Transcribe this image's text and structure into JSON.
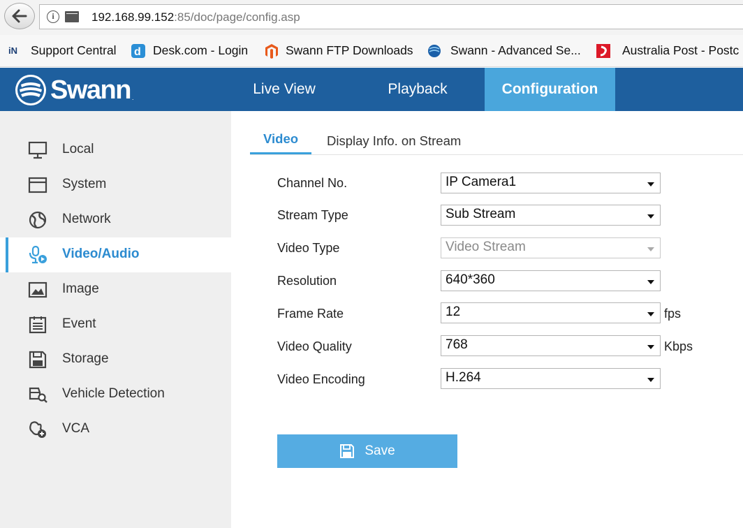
{
  "browser": {
    "url_host": "192.168.99.152",
    "url_rest": ":85/doc/page/config.asp",
    "bookmarks": [
      {
        "label": "Support Central",
        "icon": "in-icon"
      },
      {
        "label": "Desk.com - Login",
        "icon": "desk-icon"
      },
      {
        "label": "Swann FTP Downloads",
        "icon": "magento-icon"
      },
      {
        "label": "Swann - Advanced Se...",
        "icon": "swann-globe-icon"
      },
      {
        "label": "Australia Post - Postc",
        "icon": "auspost-icon"
      }
    ]
  },
  "app": {
    "brand": "Swann",
    "brand_mark": ".",
    "nav": [
      {
        "label": "Live View"
      },
      {
        "label": "Playback"
      },
      {
        "label": "Configuration",
        "active": true
      }
    ],
    "accent_color": "#4aa6dc",
    "header_color": "#1e5f9e"
  },
  "sidebar": {
    "items": [
      {
        "label": "Local",
        "icon": "monitor-icon"
      },
      {
        "label": "System",
        "icon": "window-icon"
      },
      {
        "label": "Network",
        "icon": "globe-icon"
      },
      {
        "label": "Video/Audio",
        "icon": "microphone-icon",
        "active": true
      },
      {
        "label": "Image",
        "icon": "image-icon"
      },
      {
        "label": "Event",
        "icon": "calendar-icon"
      },
      {
        "label": "Storage",
        "icon": "floppy-icon"
      },
      {
        "label": "Vehicle Detection",
        "icon": "vehicle-search-icon"
      },
      {
        "label": "VCA",
        "icon": "vca-icon"
      }
    ]
  },
  "tabs": [
    {
      "label": "Video",
      "active": true
    },
    {
      "label": "Display Info. on Stream"
    }
  ],
  "form": {
    "fields": [
      {
        "label": "Channel No.",
        "value": "IP Camera1",
        "unit": ""
      },
      {
        "label": "Stream Type",
        "value": "Sub Stream",
        "unit": ""
      },
      {
        "label": "Video Type",
        "value": "Video Stream",
        "unit": "",
        "disabled": true
      },
      {
        "label": "Resolution",
        "value": "640*360",
        "unit": ""
      },
      {
        "label": "Frame Rate",
        "value": "12",
        "unit": "fps"
      },
      {
        "label": "Video Quality",
        "value": "768",
        "unit": "Kbps"
      },
      {
        "label": "Video Encoding",
        "value": "H.264",
        "unit": ""
      }
    ],
    "save_label": "Save"
  }
}
